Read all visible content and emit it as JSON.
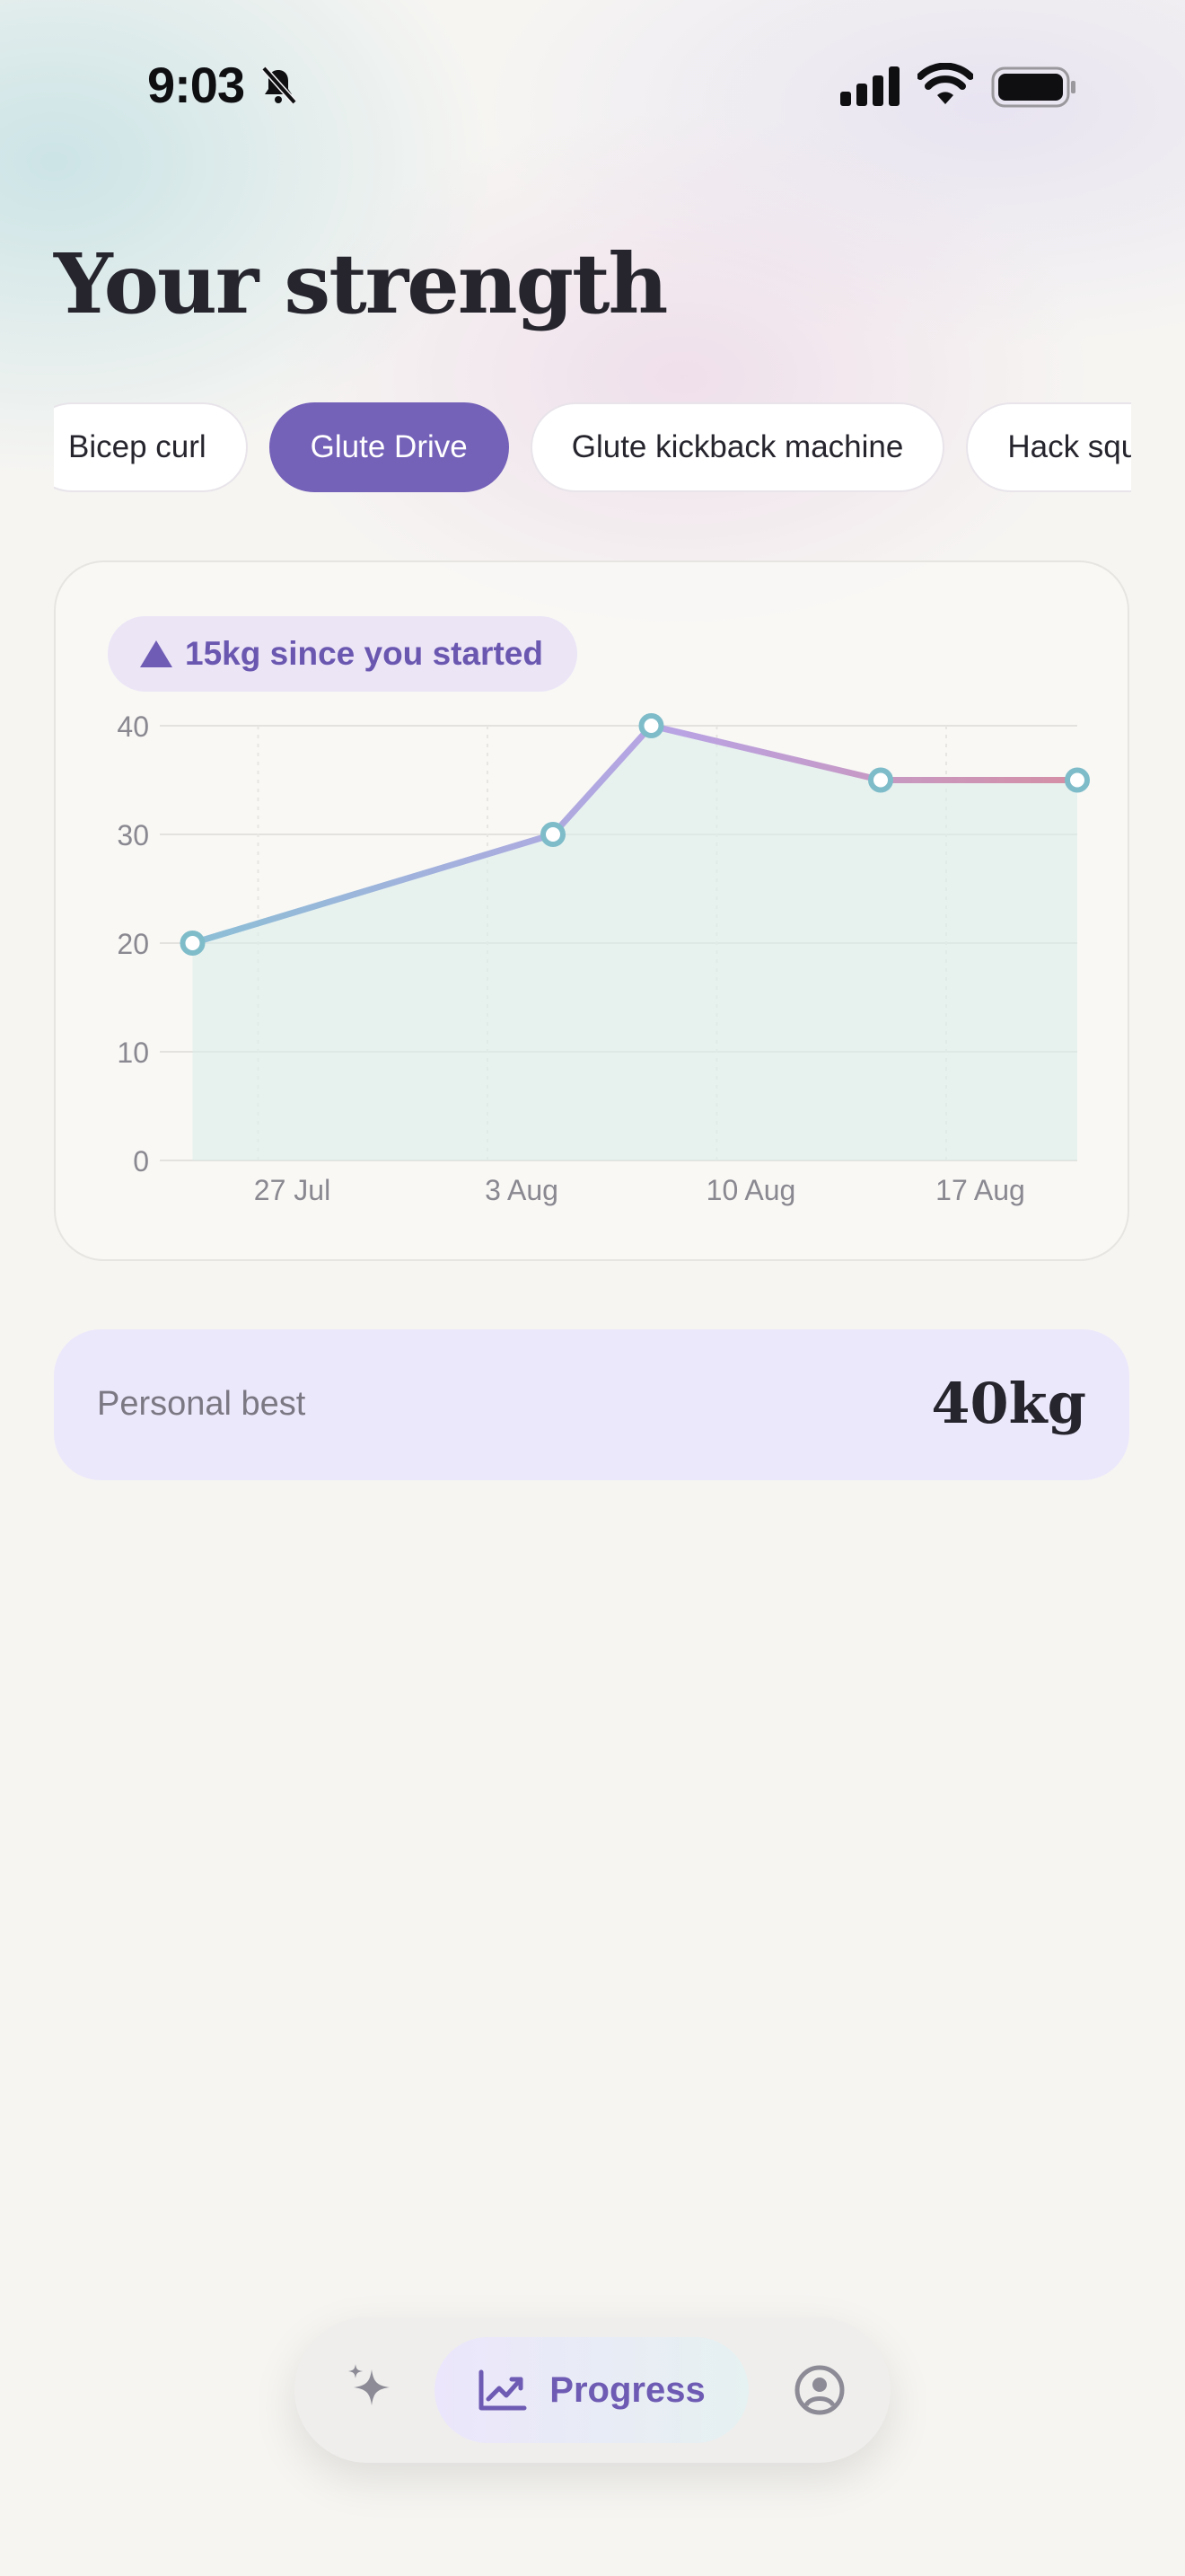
{
  "status_bar": {
    "time": "9:03"
  },
  "page": {
    "title": "Your strength"
  },
  "exercise_chips": [
    {
      "label": "Bicep curl",
      "active": false
    },
    {
      "label": "Glute Drive",
      "active": true
    },
    {
      "label": "Glute kickback machine",
      "active": false
    },
    {
      "label": "Hack squat",
      "active": false
    }
  ],
  "progress_badge": {
    "text": "15kg since you started"
  },
  "chart_data": {
    "type": "area",
    "x": [
      "2024-07-25",
      "2024-08-05",
      "2024-08-08",
      "2024-08-15",
      "2024-08-21"
    ],
    "values": [
      20,
      30,
      40,
      35,
      35
    ],
    "yticks": [
      0,
      10,
      20,
      30,
      40
    ],
    "ylim": [
      0,
      40
    ],
    "xtick_labels": [
      "27 Jul",
      "3 Aug",
      "10 Aug",
      "17 Aug"
    ],
    "grid": true,
    "colors": {
      "line_start": "#8cbfd6",
      "line_mid": "#b9a3e3",
      "line_end": "#d58fa4",
      "fill": "#d9ece9",
      "marker": "#7fbcc9"
    }
  },
  "personal_best": {
    "label": "Personal best",
    "value": "40kg"
  },
  "tab_bar": {
    "items": [
      {
        "name": "sparkle-icon",
        "label": ""
      },
      {
        "name": "chart-up-icon",
        "label": "Progress",
        "active": true
      },
      {
        "name": "profile-icon",
        "label": ""
      }
    ]
  }
}
